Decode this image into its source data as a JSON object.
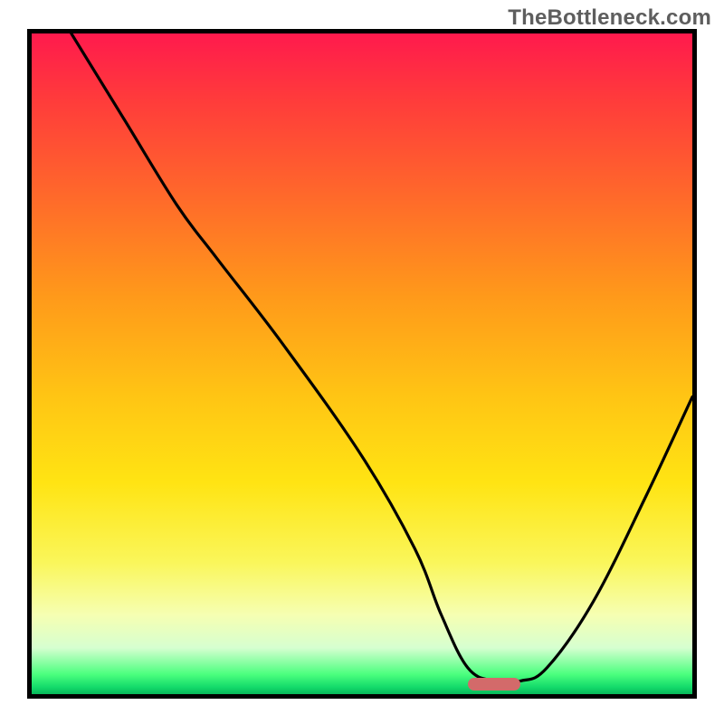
{
  "watermark": "TheBottleneck.com",
  "chart_data": {
    "type": "line",
    "title": "",
    "xlabel": "",
    "ylabel": "",
    "xlim": [
      0,
      100
    ],
    "ylim": [
      0,
      100
    ],
    "grid": false,
    "legend": false,
    "background": "gradient red→green (top→bottom)",
    "series": [
      {
        "name": "bottleneck-curve",
        "x": [
          6,
          14,
          22,
          28,
          38,
          50,
          58,
          62,
          66,
          70,
          74,
          78,
          85,
          93,
          100
        ],
        "values": [
          100,
          87,
          74,
          66,
          53,
          36,
          22,
          12,
          4,
          2,
          2,
          4,
          14,
          30,
          45
        ]
      }
    ],
    "marker": {
      "name": "optimal-range",
      "x_start": 66,
      "x_end": 74,
      "y": 1.5,
      "color": "#d36a6a"
    }
  }
}
